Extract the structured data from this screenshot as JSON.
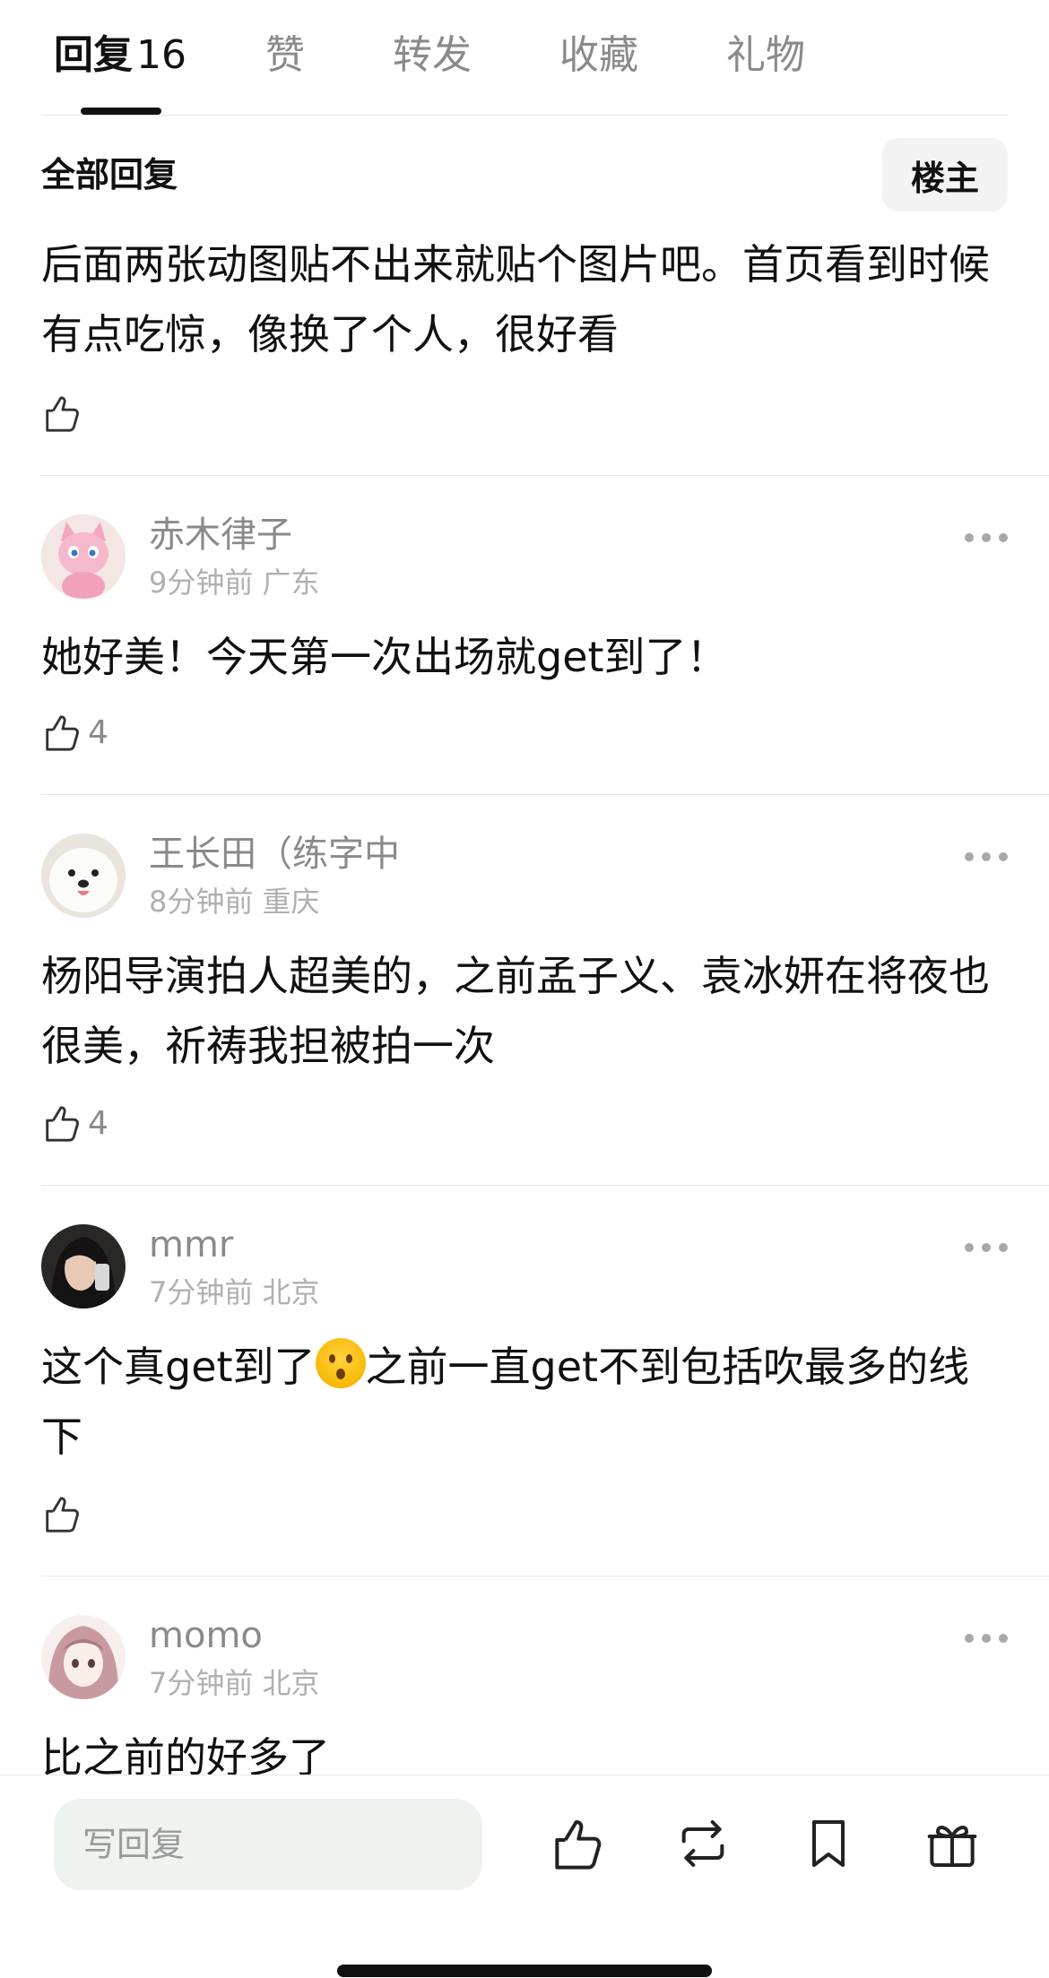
{
  "tabs": {
    "replies_label": "回复",
    "replies_count": "16",
    "likes_label": "赞",
    "reposts_label": "转发",
    "favorites_label": "收藏",
    "gifts_label": "礼物"
  },
  "section": {
    "title": "全部回复",
    "owner_button": "楼主"
  },
  "top_comment": {
    "text": "后面两张动图贴不出来就贴个图片吧。首页看到时候有点吃惊，像换了个人，很好看",
    "likes": ""
  },
  "comments": [
    {
      "username": "赤木律子",
      "time": "9分钟前",
      "location": "广东",
      "text": "她好美！今天第一次出场就get到了！",
      "likes": "4",
      "avatar": "pink-cat-plush"
    },
    {
      "username": "王长田（练字中",
      "time": "8分钟前",
      "location": "重庆",
      "text": "杨阳导演拍人超美的，之前孟子义、袁冰妍在将夜也很美，祈祷我担被拍一次",
      "likes": "4",
      "avatar": "white-dog"
    },
    {
      "username": "mmr",
      "time": "7分钟前",
      "location": "北京",
      "text_before_emoji": "这个真get到了",
      "emoji": "hushed-face",
      "text_after_emoji": "之前一直get不到包括吹最多的线下",
      "likes": "",
      "avatar": "girl-selfie"
    },
    {
      "username": "momo",
      "time": "7分钟前",
      "location": "北京",
      "text": "比之前的好多了",
      "avatar": "anime-girl"
    }
  ],
  "bottom_bar": {
    "reply_placeholder": "写回复",
    "icons": [
      "thumbs-up-icon",
      "repost-icon",
      "bookmark-icon",
      "gift-icon"
    ]
  },
  "colors": {
    "primary_text": "#111111",
    "secondary_text": "#8a8a8a",
    "input_bg": "#eef3ef"
  }
}
